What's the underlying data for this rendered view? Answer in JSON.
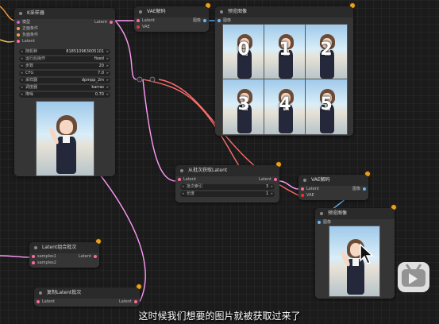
{
  "ksampler": {
    "title": "K采样器",
    "inputs": [
      "模型",
      "正面条件",
      "负面条件",
      "Latent"
    ],
    "output": "Latent",
    "widgets": [
      {
        "label": "随机种",
        "value": "818510963005101"
      },
      {
        "label": "运行后操作",
        "value": "fixed"
      },
      {
        "label": "步数",
        "value": "20"
      },
      {
        "label": "CFG",
        "value": "7.0"
      },
      {
        "label": "采样器",
        "value": "dpmpp_2m"
      },
      {
        "label": "调度器",
        "value": "karras"
      },
      {
        "label": "降噪",
        "value": "0.70"
      }
    ]
  },
  "vae_decode_top": {
    "title": "VAE解码",
    "inputs": [
      "Latent",
      "VAE"
    ],
    "output": "图像"
  },
  "preview_top": {
    "title": "预览图像",
    "input": "图像",
    "thumb_numbers": [
      "0",
      "1",
      "2",
      "3",
      "4",
      "5"
    ]
  },
  "from_batch": {
    "title": "从批次获取Latent",
    "input": "Latent",
    "output": "Latent",
    "widgets": [
      {
        "label": "批次索引",
        "value": "3"
      },
      {
        "label": "长度",
        "value": "1"
      }
    ]
  },
  "vae_decode_mid": {
    "title": "VAE解码",
    "inputs": [
      "Latent",
      "VAE"
    ],
    "output": "图像"
  },
  "preview_mid": {
    "title": "预览图像",
    "input": "图像"
  },
  "latent_combine": {
    "title": "Latent组合批次",
    "inputs": [
      "samples1",
      "samples2"
    ],
    "output": "Latent"
  },
  "latent_repeat": {
    "title": "复制Latent批次",
    "input": "Latent",
    "output": "Latent"
  },
  "subtitle": "这时候我们想要的图片就被获取过来了",
  "colors": {
    "latent_wire": "#ff9cf9",
    "vae_wire": "#ff6e6e",
    "image_wire": "#64b5f6",
    "badge": "#e8a020"
  }
}
